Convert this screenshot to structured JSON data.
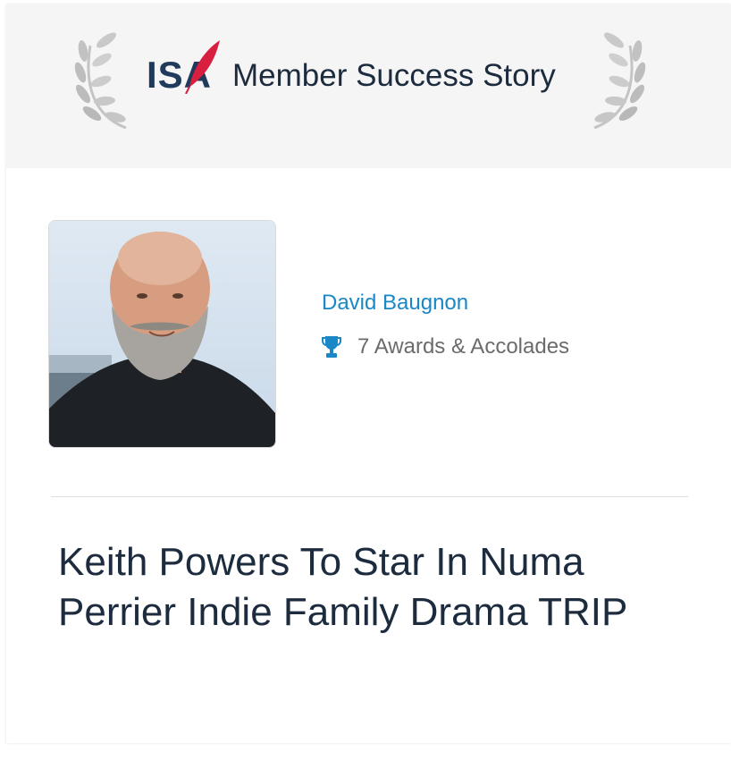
{
  "banner": {
    "logo_text": "ISA",
    "title": "Member Success Story"
  },
  "member": {
    "name": "David Baugnon",
    "awards_label": "7 Awards & Accolades",
    "award_icon": "trophy-icon"
  },
  "story": {
    "headline": "Keith Powers To Star In Numa Perrier Indie Family Drama TRIP"
  },
  "colors": {
    "banner_bg": "#f5f5f5",
    "name_link": "#1a87c6",
    "headline": "#1c2b3e",
    "logo_accent": "#d81f3f"
  }
}
